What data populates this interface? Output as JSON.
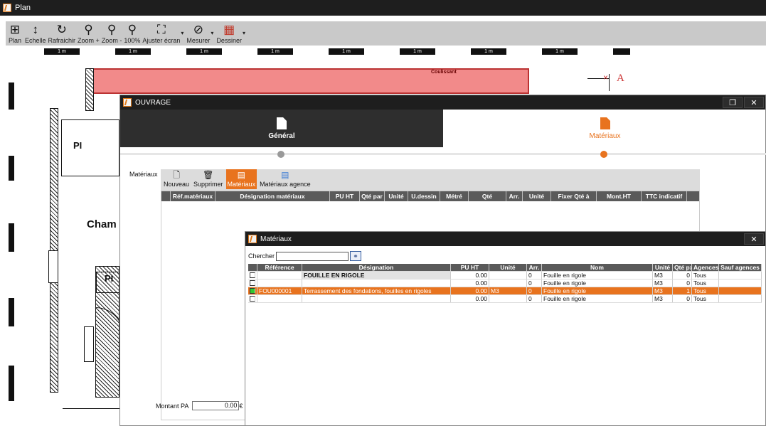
{
  "main_window": {
    "title": "Plan"
  },
  "toolbar": {
    "tools": [
      {
        "label": "Plan",
        "icon": "plan-icon"
      },
      {
        "label": "Echelle",
        "icon": "scale-icon"
      },
      {
        "label": "Rafraichir",
        "icon": "refresh-icon"
      },
      {
        "label": "Zoom +",
        "icon": "zoom-in-icon"
      },
      {
        "label": "Zoom -",
        "icon": "zoom-out-icon"
      },
      {
        "label": "100%",
        "icon": "zoom-100-icon"
      },
      {
        "label": "Ajuster écran",
        "icon": "fit-screen-icon"
      },
      {
        "label": "Mesurer",
        "icon": "measure-icon"
      },
      {
        "label": "Dessiner",
        "icon": "draw-icon"
      }
    ]
  },
  "plan": {
    "ruler_label": "1 m",
    "rooms": {
      "pi_1": "PI",
      "pi_2": "PI",
      "chambre": "Cham",
      "coulissant": "Coulissant",
      "marker": "A"
    }
  },
  "ouvrage": {
    "title": "OUVRAGE",
    "tabs": {
      "general": "Général",
      "materiaux": "Matériaux"
    },
    "materiaux_label": "Matériaux",
    "toolbar": {
      "nouveau": "Nouveau",
      "supprimer": "Supprimer",
      "materiaux": "Matériaux",
      "materiaux_agence": "Matériaux agence"
    },
    "grid_columns": [
      "Réf.matériaux",
      "Désignation matériaux",
      "PU HT",
      "Qté par",
      "Unité",
      "U.dessin",
      "Métré",
      "Qté",
      "Arr.",
      "Unité",
      "Fixer Qté à",
      "Mont.HT",
      "TTC indicatif"
    ],
    "montant_label": "Montant PA",
    "montant_value": "0.00",
    "currency": "€"
  },
  "materiaux_popup": {
    "title": "Matériaux",
    "search_label": "Chercher",
    "columns": [
      "Référence",
      "Désignation",
      "PU HT",
      "Unité",
      "Arr.",
      "Nom",
      "Unité",
      "Qté px",
      "Agences",
      "Sauf agences"
    ],
    "rows": [
      {
        "ref": "",
        "designation": "FOUILLE EN RIGOLE",
        "pu": "0.00",
        "unite": "",
        "arr": "0",
        "nom": "Fouille en rigole",
        "unite2": "M3",
        "qte": "0",
        "agences": "Tous",
        "sauf": ""
      },
      {
        "ref": "",
        "designation": "",
        "pu": "0.00",
        "unite": "",
        "arr": "0",
        "nom": "Fouille en rigole",
        "unite2": "M3",
        "qte": "0",
        "agences": "Tous",
        "sauf": ""
      },
      {
        "ref": "FOU000001",
        "designation": "Terrassement des fondations, fouilles en rigoles",
        "pu": "0.00",
        "unite": "M3",
        "arr": "0",
        "nom": "Fouille en rigole",
        "unite2": "M3",
        "qte": "1",
        "agences": "Tous",
        "sauf": ""
      },
      {
        "ref": "",
        "designation": "",
        "pu": "0.00",
        "unite": "",
        "arr": "0",
        "nom": "Fouille en rigole",
        "unite2": "M3",
        "qte": "0",
        "agences": "Tous",
        "sauf": ""
      }
    ]
  },
  "colors": {
    "accent": "#e8731e",
    "titlebar": "#1e1e1e",
    "header": "#5a5a5a",
    "selected_check": "#2fc92f",
    "wall_highlight": "#f28a8a"
  }
}
